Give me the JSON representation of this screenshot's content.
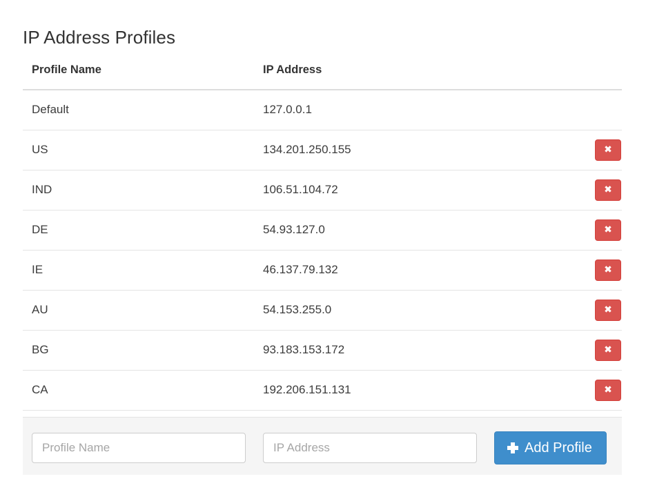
{
  "page": {
    "title": "IP Address Profiles"
  },
  "table": {
    "columns": [
      {
        "key": "profile_name",
        "label": "Profile Name"
      },
      {
        "key": "ip_address",
        "label": "IP Address"
      },
      {
        "key": "actions",
        "label": ""
      }
    ],
    "rows": [
      {
        "profile_name": "Default",
        "ip_address": "127.0.0.1",
        "deletable": false,
        "delete_icon": "close-x-icon",
        "delete_glyph": "✖"
      },
      {
        "profile_name": "US",
        "ip_address": "134.201.250.155",
        "deletable": true,
        "delete_icon": "close-x-icon",
        "delete_glyph": "✖"
      },
      {
        "profile_name": "IND",
        "ip_address": "106.51.104.72",
        "deletable": true,
        "delete_icon": "close-x-icon",
        "delete_glyph": "✖"
      },
      {
        "profile_name": "DE",
        "ip_address": "54.93.127.0",
        "deletable": true,
        "delete_icon": "close-x-icon",
        "delete_glyph": "✖"
      },
      {
        "profile_name": "IE",
        "ip_address": "46.137.79.132",
        "deletable": true,
        "delete_icon": "close-x-icon",
        "delete_glyph": "✖"
      },
      {
        "profile_name": "AU",
        "ip_address": "54.153.255.0",
        "deletable": true,
        "delete_icon": "close-x-icon",
        "delete_glyph": "✖"
      },
      {
        "profile_name": "BG",
        "ip_address": "93.183.153.172",
        "deletable": true,
        "delete_icon": "close-x-icon",
        "delete_glyph": "✖"
      },
      {
        "profile_name": "CA",
        "ip_address": "192.206.151.131",
        "deletable": true,
        "delete_icon": "close-x-icon",
        "delete_glyph": "✖"
      }
    ]
  },
  "add_form": {
    "profile_name": {
      "value": "",
      "placeholder": "Profile Name"
    },
    "ip_address": {
      "value": "",
      "placeholder": "IP Address"
    },
    "submit": {
      "label": "Add Profile",
      "icon": "plus-icon"
    }
  },
  "colors": {
    "danger": "#d9534f",
    "danger_border": "#d43f3a",
    "primary": "#3f8ecc",
    "primary_border": "#3a85c0",
    "band_background": "#f5f5f5",
    "divider": "#e4e4e4",
    "header_divider": "#dddddd",
    "text": "#333333",
    "placeholder": "#a6a6a6"
  }
}
